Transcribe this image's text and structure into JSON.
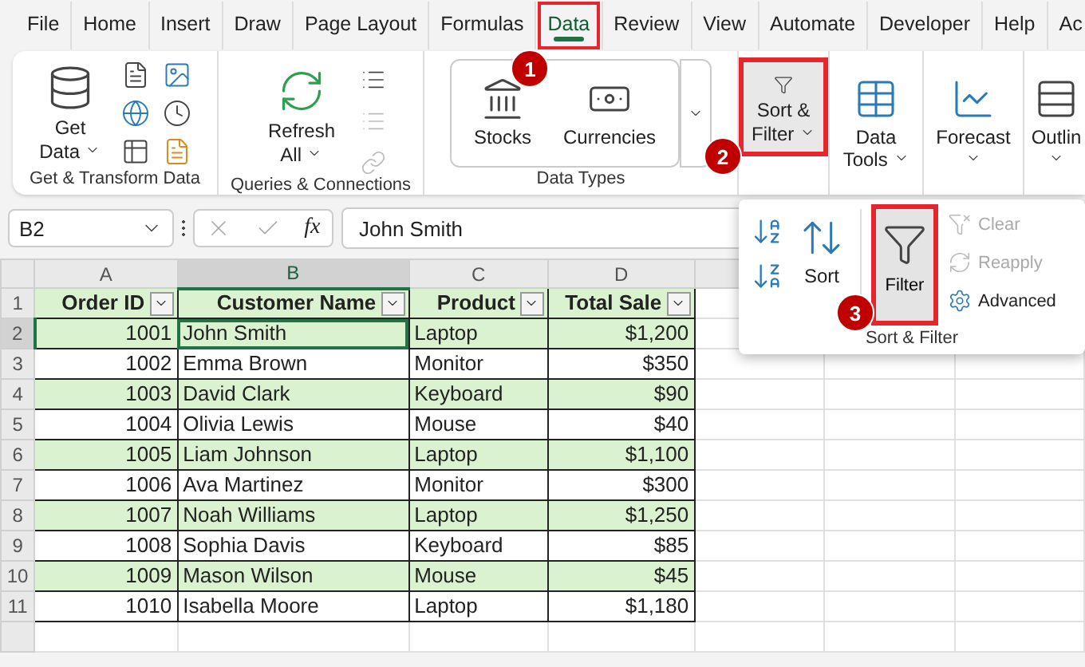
{
  "menu_tabs": [
    {
      "label": "File",
      "selected": false
    },
    {
      "label": "Home",
      "selected": false
    },
    {
      "label": "Insert",
      "selected": false
    },
    {
      "label": "Draw",
      "selected": false
    },
    {
      "label": "Page Layout",
      "selected": false
    },
    {
      "label": "Formulas",
      "selected": false
    },
    {
      "label": "Data",
      "selected": true,
      "highlighted": true,
      "callout": "1"
    },
    {
      "label": "Review",
      "selected": false
    },
    {
      "label": "View",
      "selected": false
    },
    {
      "label": "Automate",
      "selected": false
    },
    {
      "label": "Developer",
      "selected": false
    },
    {
      "label": "Help",
      "selected": false
    },
    {
      "label": "Ac",
      "selected": false
    }
  ],
  "ribbon": {
    "groups": [
      {
        "kind": "get_transform",
        "label": "Get & Transform Data",
        "button": "Get Data"
      },
      {
        "kind": "queries",
        "label": "Queries & Connections",
        "button": "Refresh All"
      },
      {
        "kind": "data_types",
        "label": "Data Types",
        "items": [
          "Stocks",
          "Currencies"
        ]
      },
      {
        "kind": "sort_filter",
        "button": "Sort & Filter",
        "highlighted": true,
        "callout": "2"
      },
      {
        "kind": "data_tools",
        "button": "Data Tools"
      },
      {
        "kind": "forecast",
        "button": "Forecast"
      },
      {
        "kind": "outline",
        "button": "Outlin"
      }
    ]
  },
  "sort_filter_menu": {
    "sort": "Sort",
    "filter": {
      "label": "Filter",
      "pressed": true,
      "highlighted": true,
      "callout": "3"
    },
    "commands": [
      {
        "label": "Clear",
        "disabled": true
      },
      {
        "label": "Reapply",
        "disabled": true
      },
      {
        "label": "Advanced",
        "disabled": false
      }
    ],
    "label": "Sort & Filter"
  },
  "formula_bar": {
    "name_box": "B2",
    "function_label": "fx",
    "value": "John Smith"
  },
  "sheet": {
    "columns": [
      {
        "letter": "A",
        "selected": false
      },
      {
        "letter": "B",
        "selected": true
      },
      {
        "letter": "C",
        "selected": false
      },
      {
        "letter": "D",
        "selected": false
      }
    ],
    "header_row": {
      "number": "1",
      "cells": [
        "Order ID",
        "Customer Name",
        "Product",
        "Total Sale"
      ]
    },
    "rows": [
      {
        "number": "2",
        "cells": [
          "1001",
          "John Smith",
          "Laptop",
          "$1,200"
        ],
        "banded": true,
        "selected": true
      },
      {
        "number": "3",
        "cells": [
          "1002",
          "Emma Brown",
          "Monitor",
          "$350"
        ],
        "banded": false,
        "selected": false
      },
      {
        "number": "4",
        "cells": [
          "1003",
          "David Clark",
          "Keyboard",
          "$90"
        ],
        "banded": true,
        "selected": false
      },
      {
        "number": "5",
        "cells": [
          "1004",
          "Olivia Lewis",
          "Mouse",
          "$40"
        ],
        "banded": false,
        "selected": false
      },
      {
        "number": "6",
        "cells": [
          "1005",
          "Liam Johnson",
          "Laptop",
          "$1,100"
        ],
        "banded": true,
        "selected": false
      },
      {
        "number": "7",
        "cells": [
          "1006",
          "Ava Martinez",
          "Monitor",
          "$300"
        ],
        "banded": false,
        "selected": false
      },
      {
        "number": "8",
        "cells": [
          "1007",
          "Noah Williams",
          "Laptop",
          "$1,250"
        ],
        "banded": true,
        "selected": false
      },
      {
        "number": "9",
        "cells": [
          "1008",
          "Sophia Davis",
          "Keyboard",
          "$85"
        ],
        "banded": false,
        "selected": false
      },
      {
        "number": "10",
        "cells": [
          "1009",
          "Mason Wilson",
          "Mouse",
          "$45"
        ],
        "banded": true,
        "selected": false
      },
      {
        "number": "11",
        "cells": [
          "1010",
          "Isabella Moore",
          "Laptop",
          "$1,180"
        ],
        "banded": false,
        "selected": false
      }
    ]
  }
}
